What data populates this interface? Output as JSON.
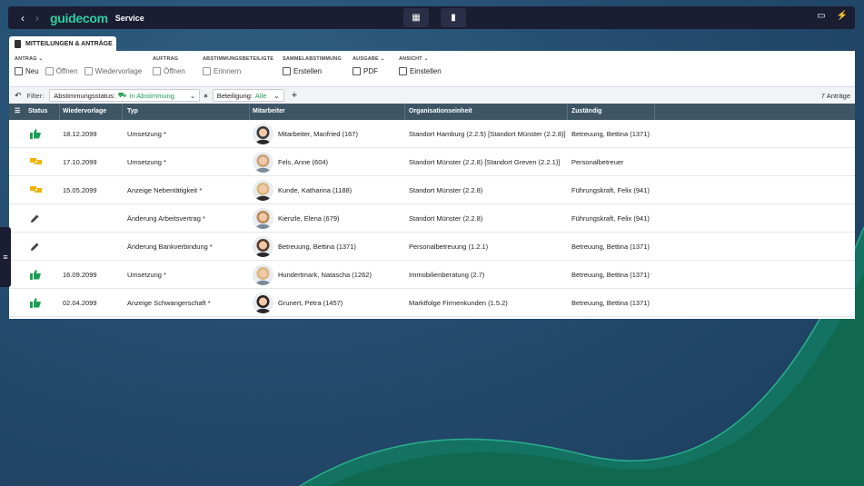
{
  "app": {
    "logo": "guidecom",
    "title": "Service"
  },
  "icons": {
    "back": "chevron-left-icon",
    "forward": "chevron-right-icon",
    "grid": "dashboard-icon",
    "doc": "document-icon",
    "monitor": "monitor-icon",
    "flash": "lightning-icon"
  },
  "tab": {
    "label": "MITTEILUNGEN & ANTRÄGE"
  },
  "ribbon": {
    "antrag": {
      "title": "ANTRAG",
      "items": [
        "Neu",
        "Öffnen",
        "Wiedervorlage"
      ]
    },
    "auftrag": {
      "title": "AUFTRAG",
      "items": [
        "Öffnen"
      ]
    },
    "abstimmung": {
      "title": "ABSTIMMUNGSBETEILIGTE",
      "items": [
        "Erinnern"
      ]
    },
    "sammel": {
      "title": "SAMMELABSTIMMUNG",
      "items": [
        "Erstellen"
      ]
    },
    "ausgabe": {
      "title": "AUSGABE",
      "items": [
        "PDF"
      ]
    },
    "ansicht": {
      "title": "ANSICHT",
      "items": [
        "Einstellen"
      ]
    }
  },
  "filter": {
    "label": "Filter:",
    "status_key": "Abstimmungsstatus:",
    "status_value": "In Abstimmung",
    "beteiligung_key": "Beteiligung:",
    "beteiligung_value": "Alle",
    "count": "7 Anträge"
  },
  "columns": [
    "Status",
    "Wiedervorlage",
    "Typ",
    "Mitarbeiter",
    "Organisationseinheit",
    "Zuständig"
  ],
  "colors": {
    "green": "#1f9d55",
    "yellow": "#f0b400",
    "header": "#3e5566"
  },
  "rows": [
    {
      "status": "thumbs-up-icon",
      "date": "18.12.2099",
      "typ": "Umsetzung *",
      "mitarbeiter": "Mitarbeiter, Manfried (167)",
      "org": "Standort Hamburg (2.2.5) [Standort Münster (2.2.8)]",
      "zust": "Betreuung, Bettina (1371)"
    },
    {
      "status": "handshake-icon",
      "date": "17.10.2099",
      "typ": "Umsetzung *",
      "mitarbeiter": "Fels, Anne (604)",
      "org": "Standort Münster (2.2.8) [Standort Greven (2.2.1)]",
      "zust": "Personalbetreuer"
    },
    {
      "status": "handshake-icon",
      "date": "15.05.2099",
      "typ": "Anzeige Nebentätigkeit *",
      "mitarbeiter": "Kunde, Katharina (1188)",
      "org": "Standort Münster (2.2.8)",
      "zust": "Führungskraft, Felix (941)"
    },
    {
      "status": "pencil-icon",
      "date": "",
      "typ": "Änderung Arbeitsvertrag *",
      "mitarbeiter": "Kienzle, Elena (679)",
      "org": "Standort Münster (2.2.8)",
      "zust": "Führungskraft, Felix (941)"
    },
    {
      "status": "pencil-icon",
      "date": "",
      "typ": "Änderung Bankverbindung *",
      "mitarbeiter": "Betreuung, Bettina (1371)",
      "org": "Personalbetreuung (1.2.1)",
      "zust": "Betreuung, Bettina (1371)"
    },
    {
      "status": "thumbs-up-icon",
      "date": "16.09.2099",
      "typ": "Umsetzung *",
      "mitarbeiter": "Hundertmark, Natascha (1262)",
      "org": "Immobilienberatung (2.7)",
      "zust": "Betreuung, Bettina (1371)"
    },
    {
      "status": "thumbs-up-icon",
      "date": "02.04.2099",
      "typ": "Anzeige Schwangerschaft *",
      "mitarbeiter": "Grunert, Petra (1457)",
      "org": "Marktfolge Firmenkunden (1.5.2)",
      "zust": "Betreuung, Bettina (1371)"
    }
  ]
}
